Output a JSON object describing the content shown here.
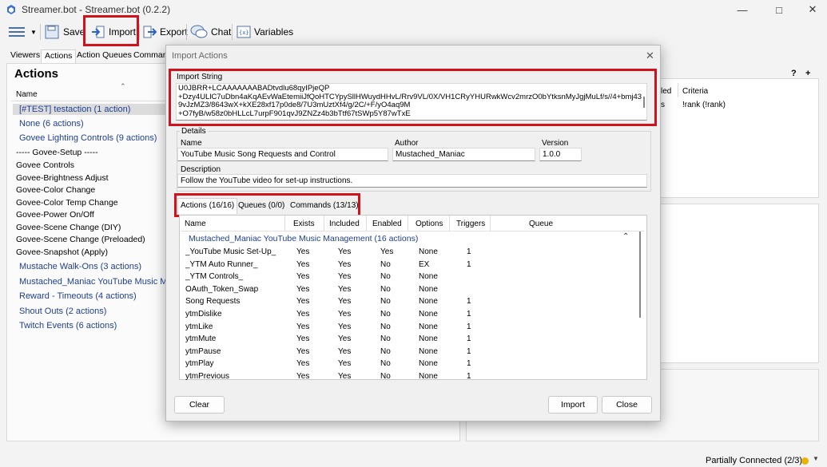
{
  "window": {
    "title": "Streamer.bot - Streamer.bot (0.2.2)"
  },
  "toolbar": {
    "save": "Save",
    "import": "Import",
    "export": "Export",
    "chat": "Chat",
    "variables": "Variables"
  },
  "tabs": [
    "Viewers",
    "Actions",
    "Action Queues",
    "Command"
  ],
  "actions_panel": {
    "title": "Actions",
    "column": "Name",
    "items": [
      {
        "label": "[#TEST] testaction (1 action)",
        "group": true
      },
      {
        "label": "None (6 actions)",
        "group": true
      },
      {
        "label": "Govee Lighting Controls (9 actions)",
        "group": true
      },
      {
        "label": "----- Govee-Setup -----",
        "group": false
      },
      {
        "label": "Govee Controls",
        "group": false
      },
      {
        "label": "Govee-Brightness Adjust",
        "group": false
      },
      {
        "label": "Govee-Color Change",
        "group": false
      },
      {
        "label": "Govee-Color Temp Change",
        "group": false
      },
      {
        "label": "Govee-Power On/Off",
        "group": false
      },
      {
        "label": "Govee-Scene Change (DIY)",
        "group": false
      },
      {
        "label": "Govee-Scene Change (Preloaded)",
        "group": false
      },
      {
        "label": "Govee-Snapshot (Apply)",
        "group": false
      },
      {
        "label": "Mustache Walk-Ons (3 actions)",
        "group": true
      },
      {
        "label": "Mustached_Maniac YouTube Music Mar",
        "group": true
      },
      {
        "label": "Reward - Timeouts (4 actions)",
        "group": true
      },
      {
        "label": "Shout Outs (2 actions)",
        "group": true
      },
      {
        "label": "Twitch Events (6 actions)",
        "group": true
      }
    ]
  },
  "right_panel": {
    "help": "?",
    "add": "+",
    "col_enabled": "led",
    "col_criteria": "Criteria",
    "row_status": "s",
    "row_criteria": "!rank  (!rank)"
  },
  "dialog": {
    "title": "Import Actions",
    "import_label": "Import String",
    "import_lines": [
      "U0JBRR+LCAAAAAAABADtvdlu68qyIPjeQP",
      "+Dzy4ULlC7uDbn4aKqAEvWaEtemiiJfQoHTCYpySllHWuydHHvL/Rrv9VL/0X/VH1CRyYHURwkWcv2mrzO0bYtksnMyJgjMuLf/s//4+bmj43",
      "9vJzMZ3/8643wX+kXE28xf17p0de8/7U3mUztXf4/g/2C/+F/yO4aq9M",
      "+O7fyB/w58z0bHLLcL7urpF901qvJ9ZNZz4b3bTtf67tSWp5Y87wTxE"
    ],
    "details_label": "Details",
    "name_label": "Name",
    "name_value": "YouTube Music Song Requests and Control",
    "author_label": "Author",
    "author_value": "Mustached_Maniac",
    "version_label": "Version",
    "version_value": "1.0.0",
    "description_label": "Description",
    "description_value": "Follow the YouTube video for set-up instructions.",
    "subtabs": [
      "Actions (16/16)",
      "Queues (0/0)",
      "Commands (13/13)"
    ],
    "columns": [
      "Name",
      "Exists",
      "Included",
      "Enabled",
      "Options",
      "Triggers",
      "Queue"
    ],
    "group_label": "Mustached_Maniac YouTube Music Management (16 actions)",
    "rows": [
      {
        "name": "_YouTube Music Set-Up_",
        "exists": "Yes",
        "included": "Yes",
        "enabled": "Yes",
        "options": "None",
        "triggers": "1"
      },
      {
        "name": "_YTM Auto Runner_",
        "exists": "Yes",
        "included": "Yes",
        "enabled": "No",
        "options": "EX",
        "triggers": "1"
      },
      {
        "name": "_YTM Controls_",
        "exists": "Yes",
        "included": "Yes",
        "enabled": "No",
        "options": "None",
        "triggers": ""
      },
      {
        "name": "OAuth_Token_Swap",
        "exists": "Yes",
        "included": "Yes",
        "enabled": "No",
        "options": "None",
        "triggers": ""
      },
      {
        "name": "Song Requests",
        "exists": "Yes",
        "included": "Yes",
        "enabled": "No",
        "options": "None",
        "triggers": "1"
      },
      {
        "name": "ytmDislike",
        "exists": "Yes",
        "included": "Yes",
        "enabled": "No",
        "options": "None",
        "triggers": "1"
      },
      {
        "name": "ytmLike",
        "exists": "Yes",
        "included": "Yes",
        "enabled": "No",
        "options": "None",
        "triggers": "1"
      },
      {
        "name": "ytmMute",
        "exists": "Yes",
        "included": "Yes",
        "enabled": "No",
        "options": "None",
        "triggers": "1"
      },
      {
        "name": "ytmPause",
        "exists": "Yes",
        "included": "Yes",
        "enabled": "No",
        "options": "None",
        "triggers": "1"
      },
      {
        "name": "ytmPlay",
        "exists": "Yes",
        "included": "Yes",
        "enabled": "No",
        "options": "None",
        "triggers": "1"
      },
      {
        "name": "ytmPrevious",
        "exists": "Yes",
        "included": "Yes",
        "enabled": "No",
        "options": "None",
        "triggers": "1"
      }
    ],
    "buttons": {
      "clear": "Clear",
      "import": "Import",
      "close": "Close"
    }
  },
  "status": {
    "text": "Partially Connected (2/3)",
    "dot_color": "#e8b400"
  },
  "colors": {
    "highlight": "#d0121c",
    "group_text": "#1f3f8f"
  }
}
